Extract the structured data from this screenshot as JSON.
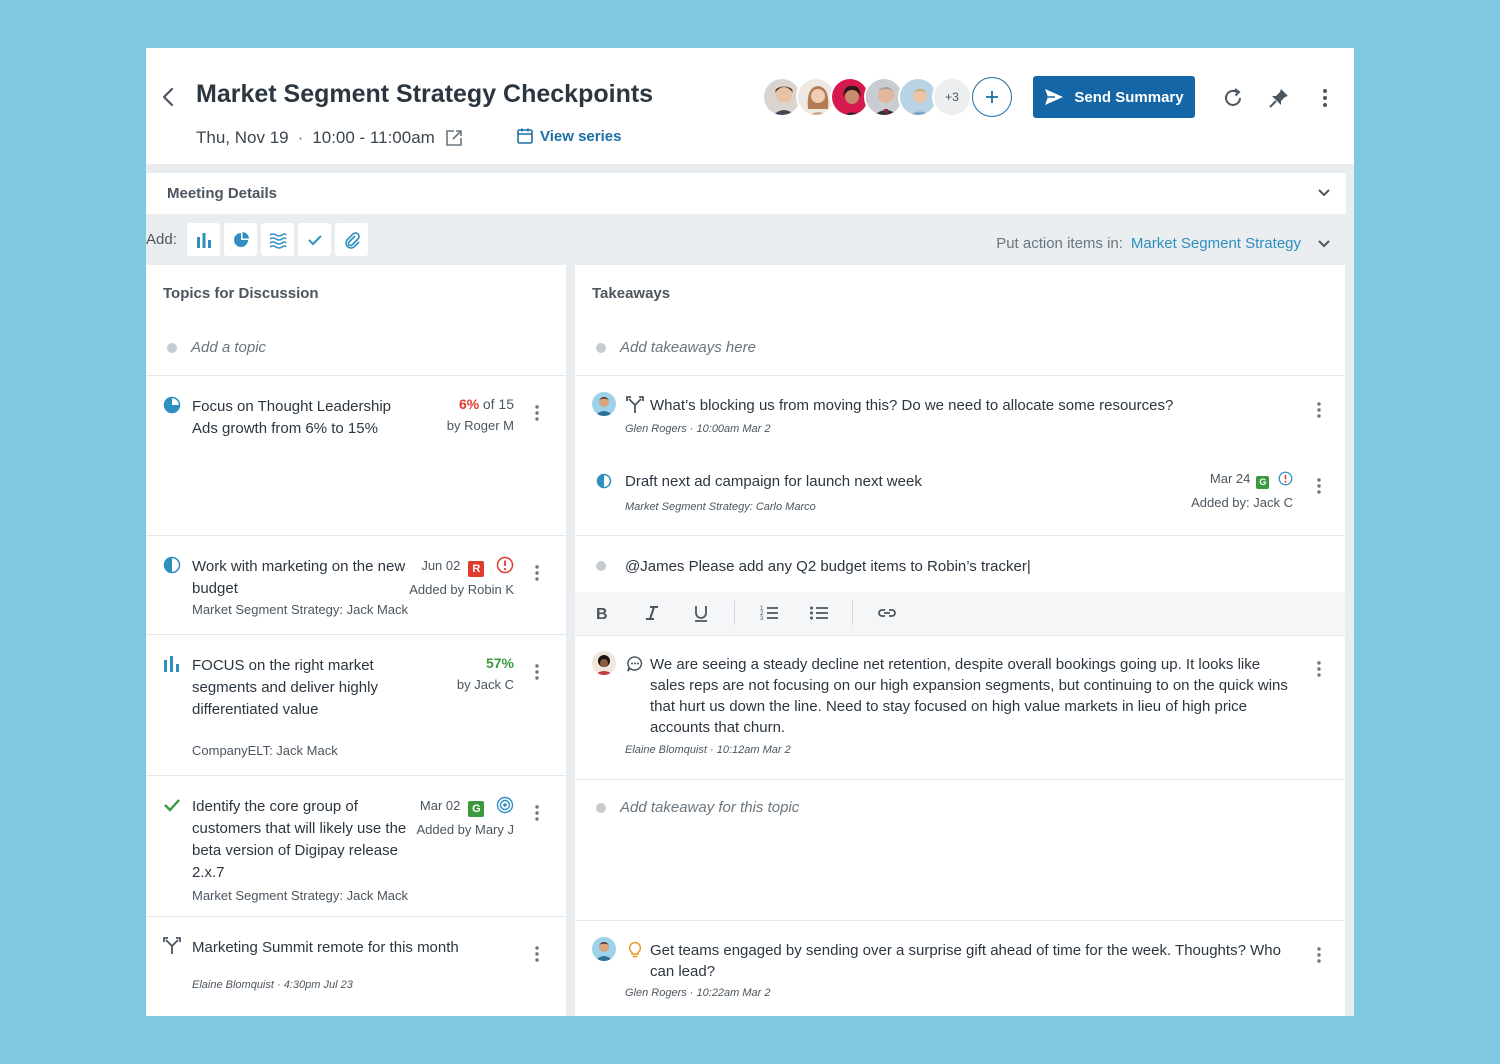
{
  "header": {
    "title": "Market Segment Strategy Checkpoints",
    "date": "Thu, Nov 19",
    "separator": "·",
    "time": "10:00 - 11:00am",
    "view_series": "View series",
    "more_attendees": "+3",
    "send_summary": "Send Summary"
  },
  "details": {
    "label": "Meeting Details"
  },
  "addbar": {
    "add_label": "Add:",
    "put_label": "Put action items in:",
    "put_value": "Market Segment Strategy"
  },
  "topics": {
    "title": "Topics for Discussion",
    "placeholder": "Add a topic",
    "items": [
      {
        "icon": "pie-chart-icon",
        "text": "Focus on Thought Leadership Ads growth from 6% to 15%",
        "pct": "6%",
        "of": "of 15",
        "by": "by Roger M"
      },
      {
        "icon": "half-circle-icon",
        "text": "Work with marketing on the new budget",
        "date": "Jun 02",
        "badge": "R",
        "added": "Added by Robin K",
        "sub": "Market Segment Strategy: Jack Mack"
      },
      {
        "icon": "bar-chart-icon",
        "text": "FOCUS on the right market segments and deliver highly differentiated value",
        "pct": "57%",
        "by": "by Jack C",
        "sub": "CompanyELT: Jack Mack"
      },
      {
        "icon": "check-icon",
        "text": "Identify the core group of customers that will likely use the beta version of Digipay release 2.x.7",
        "date": "Mar 02",
        "badge": "G",
        "added": "Added by Mary J",
        "sub": "Market Segment Strategy: Jack Mack"
      },
      {
        "icon": "fork-icon",
        "text": "Marketing Summit remote for this month",
        "meta": "Elaine Blomquist  ·  4:30pm Jul 23"
      }
    ]
  },
  "takeaways": {
    "title": "Takeaways",
    "placeholder": "Add takeaways here",
    "items": [
      {
        "text": "What’s blocking us from moving this? Do we need to allocate some resources?",
        "meta": "Glen Rogers  ·  10:00am Mar 2"
      },
      {
        "text": "Draft next ad campaign for launch next week",
        "meta": "Market Segment Strategy: Carlo Marco",
        "date": "Mar 24",
        "badge": "G",
        "added": "Added by: Jack C"
      },
      {
        "text": "@James Please add any Q2 budget items to Robin’s tracker|"
      },
      {
        "text": "We are seeing a steady decline net retention, despite overall bookings going up. It looks like sales reps are not focusing on our high expansion segments, but continuing to on the quick wins that hurt us down the line. Need to stay focused on high value markets in lieu of high price accounts that churn.",
        "meta": "Elaine Blomquist  ·  10:12am Mar 2"
      },
      {
        "placeholder": "Add takeaway for this topic"
      },
      {
        "text": "Get teams engaged by sending over a surprise gift ahead of time for the week. Thoughts? Who can lead?",
        "meta": "Glen Rogers  ·  10:22am Mar 2"
      }
    ]
  },
  "colors": {
    "accent": "#1466a6",
    "link": "#2f8fc1",
    "danger": "#e03b2f",
    "success": "#3a9a3d",
    "bg": "#7ec8e0"
  }
}
